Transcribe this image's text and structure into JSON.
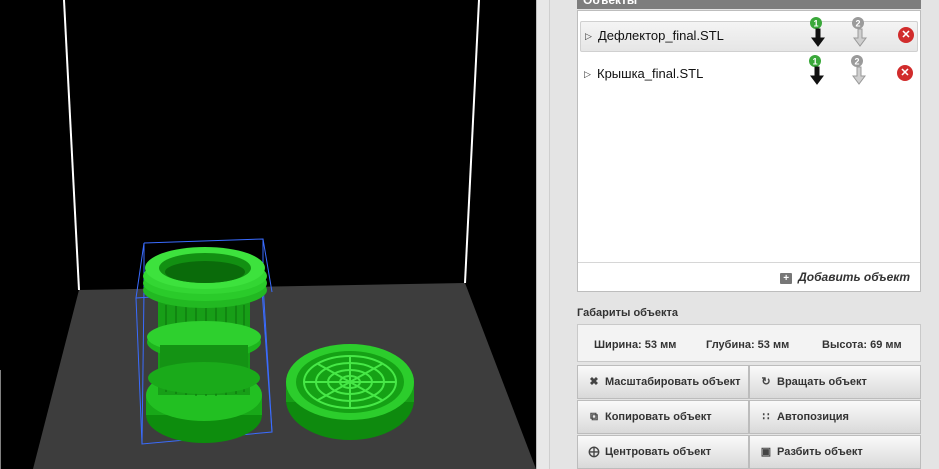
{
  "objects_panel": {
    "title": "Объекты",
    "items": [
      {
        "name": "Дефлектор_final.STL",
        "selected": true,
        "extruder_1": "1",
        "extruder_2": "2"
      },
      {
        "name": "Крышка_final.STL",
        "selected": false,
        "extruder_1": "1",
        "extruder_2": "2"
      }
    ],
    "add_object_label": "Добавить объект"
  },
  "dimensions": {
    "title": "Габариты объекта",
    "width": "Ширина: 53 мм",
    "depth": "Глубина: 53 мм",
    "height": "Высота: 69 мм"
  },
  "actions": {
    "scale": "Масштабировать объект",
    "rotate": "Вращать объект",
    "copy": "Копировать объект",
    "autoposition": "Автопозиция",
    "center": "Центровать объект",
    "split": "Разбить объект"
  },
  "colors": {
    "model": "#1fb81f",
    "selection_box": "#3a6cff",
    "bed": "#3d3d3d",
    "extruder_active": "#3aa83a",
    "extruder_inactive": "#9a9a9a",
    "delete": "#d12c2c"
  },
  "icons": {
    "expand": "triangle-right-icon",
    "extruder": "extruder-arrow-icon",
    "delete": "close-circle-icon",
    "add": "plus-box-icon",
    "scale": "scale-arrows-icon",
    "rotate": "rotate-icon",
    "copy": "copy-icon",
    "autoposition": "grid-icon",
    "center": "center-icon",
    "split": "split-icon"
  }
}
